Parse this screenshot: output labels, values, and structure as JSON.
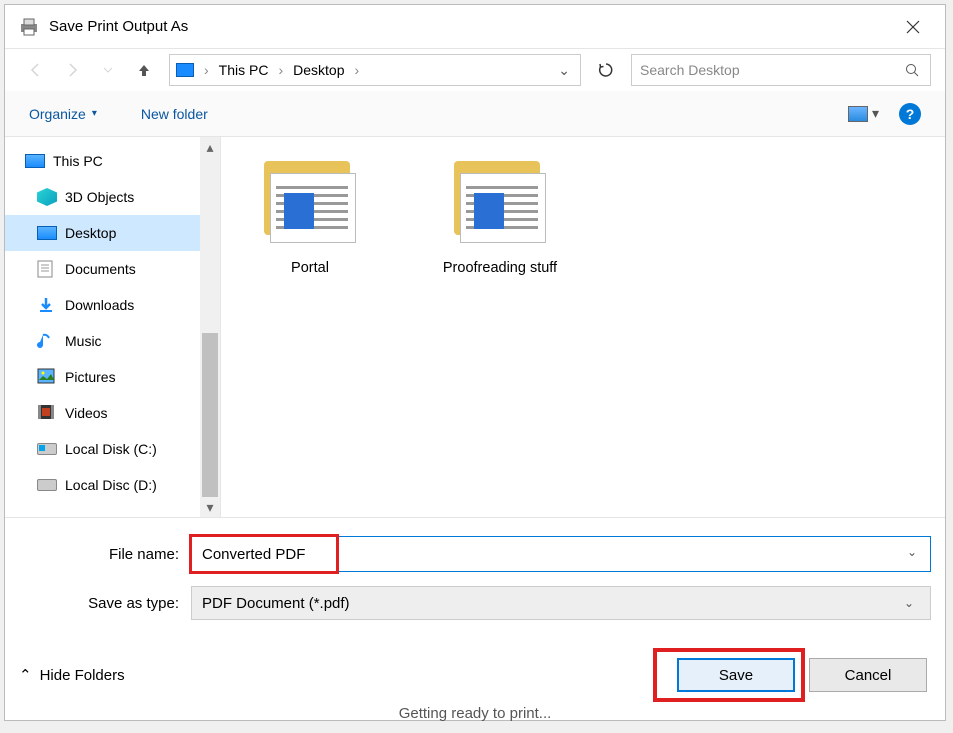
{
  "title": "Save Print Output As",
  "breadcrumb": {
    "item1": "This PC",
    "item2": "Desktop"
  },
  "search": {
    "placeholder": "Search Desktop"
  },
  "toolbar": {
    "organize": "Organize",
    "newfolder": "New folder"
  },
  "nav": {
    "thispc": "This PC",
    "objects3d": "3D Objects",
    "desktop": "Desktop",
    "documents": "Documents",
    "downloads": "Downloads",
    "music": "Music",
    "pictures": "Pictures",
    "videos": "Videos",
    "diskc": "Local Disk (C:)",
    "diskd": "Local Disc (D:)"
  },
  "folders": {
    "f1": "Portal",
    "f2": "Proofreading stuff"
  },
  "fields": {
    "name_label": "File name:",
    "name_value": "Converted PDF",
    "type_label": "Save as type:",
    "type_value": "PDF Document (*.pdf)"
  },
  "footer": {
    "hide": "Hide Folders",
    "save": "Save",
    "cancel": "Cancel"
  },
  "background_text": "Getting ready to print..."
}
